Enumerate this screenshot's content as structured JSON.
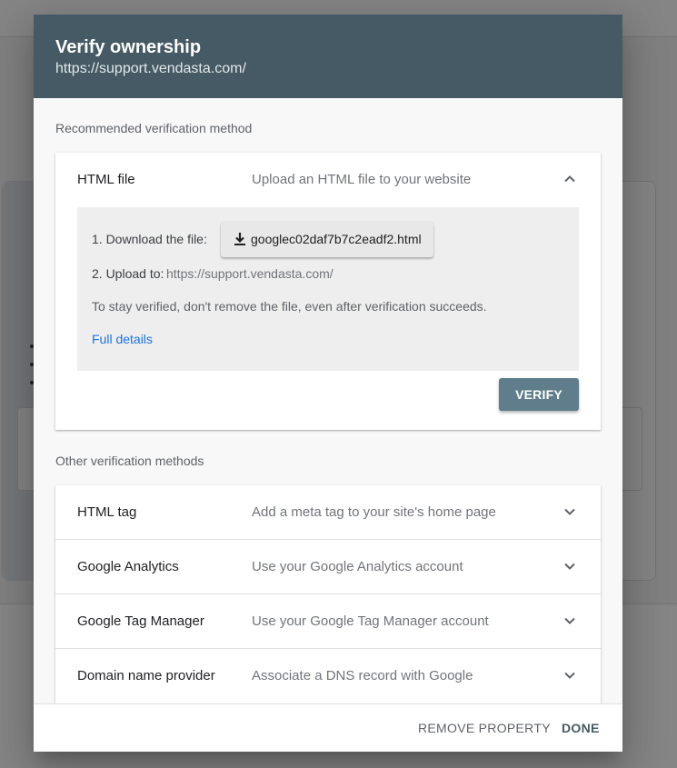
{
  "dialog": {
    "title": "Verify ownership",
    "subtitle": "https://support.vendasta.com/",
    "header_color": "#455a64"
  },
  "recommended": {
    "section_label": "Recommended verification method",
    "method": {
      "name": "HTML file",
      "description": "Upload an HTML file to your website",
      "chevron_icon": "chevron-up-icon",
      "expanded": true,
      "step1_label": "1. Download the file:",
      "download_icon": "download-icon",
      "download_file": "googlec02daf7b7c2eadf2.html",
      "step2_label": "2. Upload to:",
      "step2_url": "https://support.vendasta.com/",
      "note": "To stay verified, don't remove the file, even after verification succeeds.",
      "full_details_link": "Full details",
      "verify_button": "VERIFY"
    }
  },
  "other": {
    "section_label": "Other verification methods",
    "methods": [
      {
        "name": "HTML tag",
        "description": "Add a meta tag to your site's home page",
        "chevron_icon": "chevron-down-icon"
      },
      {
        "name": "Google Analytics",
        "description": "Use your Google Analytics account",
        "chevron_icon": "chevron-down-icon"
      },
      {
        "name": "Google Tag Manager",
        "description": "Use your Google Tag Manager account",
        "chevron_icon": "chevron-down-icon"
      },
      {
        "name": "Domain name provider",
        "description": "Associate a DNS record with Google",
        "chevron_icon": "chevron-down-icon"
      }
    ]
  },
  "footer": {
    "remove_button": "REMOVE PROPERTY",
    "done_button": "DONE"
  },
  "colors": {
    "verify_button": "#5f7d8a",
    "link": "#1a73e8",
    "panel_background": "#eeeeee"
  }
}
